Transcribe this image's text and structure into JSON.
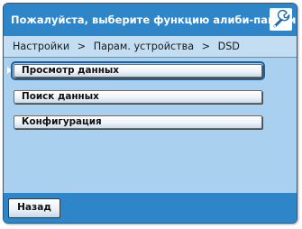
{
  "header": {
    "title": "Пожалуйста, выберите функцию алиби-памяти",
    "icon": "wrench-icon"
  },
  "breadcrumb": {
    "items": [
      "Настройки",
      ">",
      "Парам. устройства",
      ">",
      "DSD"
    ]
  },
  "menu": {
    "items": [
      {
        "label": "Просмотр данных",
        "selected": true
      },
      {
        "label": "Поиск данных",
        "selected": false
      },
      {
        "label": "Конфигурация",
        "selected": false
      }
    ]
  },
  "footer": {
    "back_label": "Назад"
  },
  "colors": {
    "header_bg": "#2e86c8",
    "body_bg": "#a9d0ef",
    "breadcrumb_bg": "#c3ddf2",
    "selection_outline": "#1e5f98"
  }
}
